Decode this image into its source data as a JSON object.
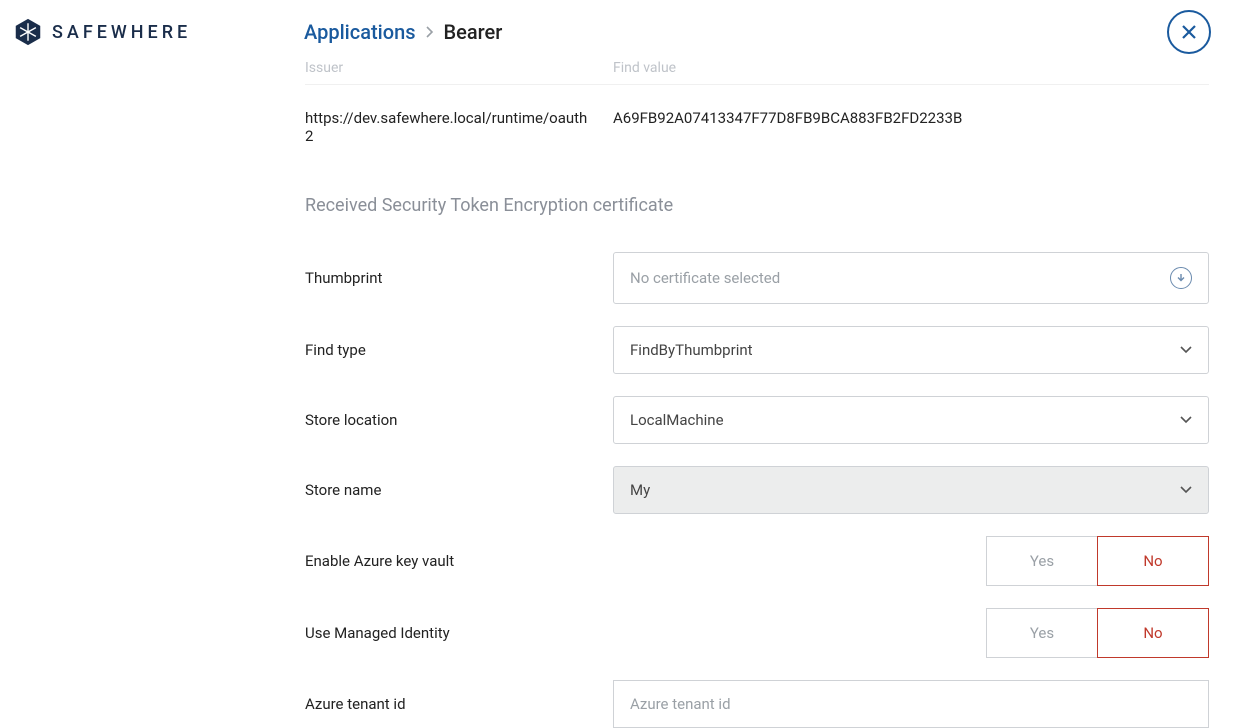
{
  "logo_text": "SAFEWHERE",
  "breadcrumb": {
    "parent": "Applications",
    "current": "Bearer"
  },
  "table_headers": {
    "issuer": "Issuer",
    "find_value": "Find value"
  },
  "issuer_row": {
    "issuer": "https://dev.safewhere.local/runtime/oauth2",
    "find_value": "A69FB92A07413347F77D8FB9BCA883FB2FD2233B"
  },
  "section_title": "Received Security Token Encryption certificate",
  "fields": {
    "thumbprint": {
      "label": "Thumbprint",
      "placeholder": "No certificate selected"
    },
    "find_type": {
      "label": "Find type",
      "value": "FindByThumbprint"
    },
    "store_location": {
      "label": "Store location",
      "value": "LocalMachine"
    },
    "store_name": {
      "label": "Store name",
      "value": "My"
    },
    "enable_azure_key_vault": {
      "label": "Enable Azure key vault"
    },
    "use_managed_identity": {
      "label": "Use Managed Identity"
    },
    "azure_tenant_id": {
      "label": "Azure tenant id",
      "placeholder": "Azure tenant id"
    }
  },
  "toggle": {
    "yes": "Yes",
    "no": "No"
  }
}
